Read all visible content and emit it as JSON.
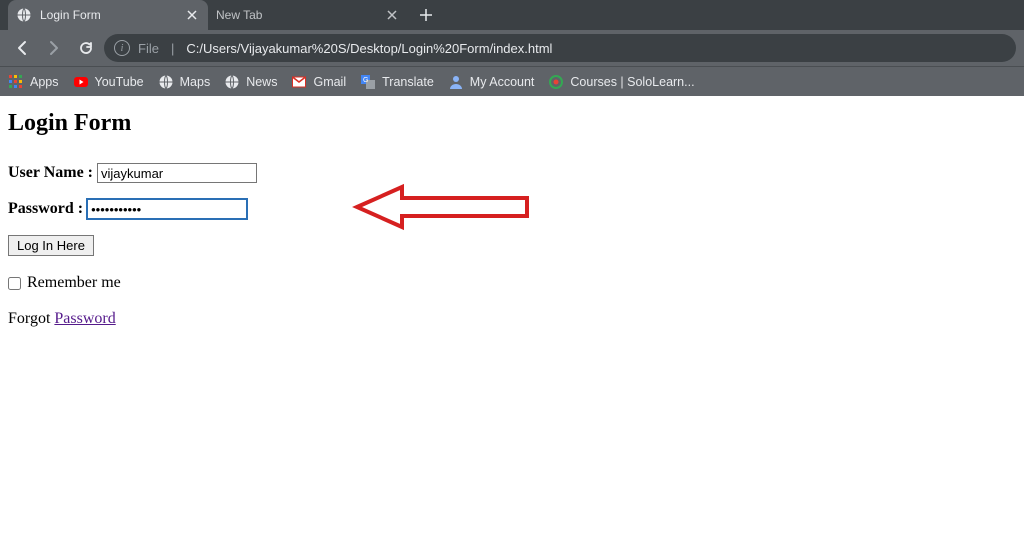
{
  "tabs": [
    {
      "title": "Login Form",
      "active": true
    },
    {
      "title": "New Tab",
      "active": false
    }
  ],
  "address": {
    "scheme": "File",
    "path": "C:/Users/Vijayakumar%20S/Desktop/Login%20Form/index.html"
  },
  "bookmarks": {
    "apps": "Apps",
    "youtube": "YouTube",
    "maps": "Maps",
    "news": "News",
    "gmail": "Gmail",
    "translate": "Translate",
    "myaccount": "My Account",
    "courses": "Courses | SoloLearn..."
  },
  "page": {
    "heading": "Login Form",
    "username_label": "User Name :",
    "username_value": "vijaykumar",
    "password_label": "Password :",
    "password_value": "•••••••••••",
    "login_button": "Log In Here",
    "remember_label": "Remember me",
    "forgot_prefix": "Forgot ",
    "forgot_link": "Password"
  },
  "colors": {
    "arrow": "#d62020"
  }
}
